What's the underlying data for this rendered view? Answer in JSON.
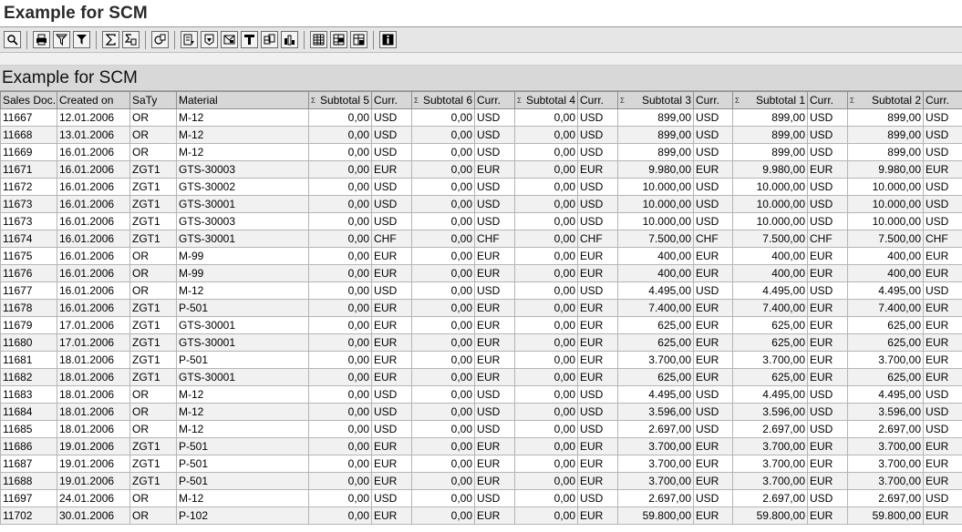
{
  "window": {
    "title": "Example for SCM"
  },
  "toolbar": {
    "buttons": [
      {
        "name": "details-icon",
        "group": 1
      },
      {
        "name": "print-icon",
        "group": 2
      },
      {
        "name": "filter-icon",
        "group": 2
      },
      {
        "name": "set-filter-icon",
        "group": 2
      },
      {
        "name": "total-icon",
        "group": 3
      },
      {
        "name": "subtotal-icon",
        "group": 3
      },
      {
        "name": "print-preview-icon",
        "group": 4
      },
      {
        "name": "export-icon",
        "group": 5
      },
      {
        "name": "local-file-icon",
        "group": 5
      },
      {
        "name": "mail-icon",
        "group": 5
      },
      {
        "name": "word-processing-icon",
        "group": 5
      },
      {
        "name": "spreadsheet-icon",
        "group": 5
      },
      {
        "name": "graphic-icon",
        "group": 5
      },
      {
        "name": "change-layout-icon",
        "group": 6
      },
      {
        "name": "select-layout-icon",
        "group": 6
      },
      {
        "name": "save-layout-icon",
        "group": 6
      },
      {
        "name": "information-icon",
        "group": 7
      }
    ]
  },
  "alv": {
    "title": "Example for SCM",
    "columns": [
      {
        "label": "Sales Doc.",
        "num": false,
        "sigma": false
      },
      {
        "label": "Created on",
        "num": false,
        "sigma": false
      },
      {
        "label": "SaTy",
        "num": false,
        "sigma": false
      },
      {
        "label": "Material",
        "num": false,
        "sigma": false
      },
      {
        "label": "Subtotal 5",
        "num": true,
        "sigma": true
      },
      {
        "label": "Curr.",
        "num": false,
        "sigma": false
      },
      {
        "label": "Subtotal 6",
        "num": true,
        "sigma": true
      },
      {
        "label": "Curr.",
        "num": false,
        "sigma": false
      },
      {
        "label": "Subtotal 4",
        "num": true,
        "sigma": true
      },
      {
        "label": "Curr.",
        "num": false,
        "sigma": false
      },
      {
        "label": "Subtotal 3",
        "num": true,
        "sigma": true
      },
      {
        "label": "Curr.",
        "num": false,
        "sigma": false
      },
      {
        "label": "Subtotal 1",
        "num": true,
        "sigma": true
      },
      {
        "label": "Curr.",
        "num": false,
        "sigma": false
      },
      {
        "label": "Subtotal 2",
        "num": true,
        "sigma": true
      },
      {
        "label": "Curr.",
        "num": false,
        "sigma": false
      }
    ],
    "sigma_symbol": "Σ",
    "rows": [
      [
        "11667",
        "12.01.2006",
        "OR",
        "M-12",
        "0,00",
        "USD",
        "0,00",
        "USD",
        "0,00",
        "USD",
        "899,00",
        "USD",
        "899,00",
        "USD",
        "899,00",
        "USD"
      ],
      [
        "11668",
        "13.01.2006",
        "OR",
        "M-12",
        "0,00",
        "USD",
        "0,00",
        "USD",
        "0,00",
        "USD",
        "899,00",
        "USD",
        "899,00",
        "USD",
        "899,00",
        "USD"
      ],
      [
        "11669",
        "16.01.2006",
        "OR",
        "M-12",
        "0,00",
        "USD",
        "0,00",
        "USD",
        "0,00",
        "USD",
        "899,00",
        "USD",
        "899,00",
        "USD",
        "899,00",
        "USD"
      ],
      [
        "11671",
        "16.01.2006",
        "ZGT1",
        "GTS-30003",
        "0,00",
        "EUR",
        "0,00",
        "EUR",
        "0,00",
        "EUR",
        "9.980,00",
        "EUR",
        "9.980,00",
        "EUR",
        "9.980,00",
        "EUR"
      ],
      [
        "11672",
        "16.01.2006",
        "ZGT1",
        "GTS-30002",
        "0,00",
        "USD",
        "0,00",
        "USD",
        "0,00",
        "USD",
        "10.000,00",
        "USD",
        "10.000,00",
        "USD",
        "10.000,00",
        "USD"
      ],
      [
        "11673",
        "16.01.2006",
        "ZGT1",
        "GTS-30001",
        "0,00",
        "USD",
        "0,00",
        "USD",
        "0,00",
        "USD",
        "10.000,00",
        "USD",
        "10.000,00",
        "USD",
        "10.000,00",
        "USD"
      ],
      [
        "11673",
        "16.01.2006",
        "ZGT1",
        "GTS-30003",
        "0,00",
        "USD",
        "0,00",
        "USD",
        "0,00",
        "USD",
        "10.000,00",
        "USD",
        "10.000,00",
        "USD",
        "10.000,00",
        "USD"
      ],
      [
        "11674",
        "16.01.2006",
        "ZGT1",
        "GTS-30001",
        "0,00",
        "CHF",
        "0,00",
        "CHF",
        "0,00",
        "CHF",
        "7.500,00",
        "CHF",
        "7.500,00",
        "CHF",
        "7.500,00",
        "CHF"
      ],
      [
        "11675",
        "16.01.2006",
        "OR",
        "M-99",
        "0,00",
        "EUR",
        "0,00",
        "EUR",
        "0,00",
        "EUR",
        "400,00",
        "EUR",
        "400,00",
        "EUR",
        "400,00",
        "EUR"
      ],
      [
        "11676",
        "16.01.2006",
        "OR",
        "M-99",
        "0,00",
        "EUR",
        "0,00",
        "EUR",
        "0,00",
        "EUR",
        "400,00",
        "EUR",
        "400,00",
        "EUR",
        "400,00",
        "EUR"
      ],
      [
        "11677",
        "16.01.2006",
        "OR",
        "M-12",
        "0,00",
        "USD",
        "0,00",
        "USD",
        "0,00",
        "USD",
        "4.495,00",
        "USD",
        "4.495,00",
        "USD",
        "4.495,00",
        "USD"
      ],
      [
        "11678",
        "16.01.2006",
        "ZGT1",
        "P-501",
        "0,00",
        "EUR",
        "0,00",
        "EUR",
        "0,00",
        "EUR",
        "7.400,00",
        "EUR",
        "7.400,00",
        "EUR",
        "7.400,00",
        "EUR"
      ],
      [
        "11679",
        "17.01.2006",
        "ZGT1",
        "GTS-30001",
        "0,00",
        "EUR",
        "0,00",
        "EUR",
        "0,00",
        "EUR",
        "625,00",
        "EUR",
        "625,00",
        "EUR",
        "625,00",
        "EUR"
      ],
      [
        "11680",
        "17.01.2006",
        "ZGT1",
        "GTS-30001",
        "0,00",
        "EUR",
        "0,00",
        "EUR",
        "0,00",
        "EUR",
        "625,00",
        "EUR",
        "625,00",
        "EUR",
        "625,00",
        "EUR"
      ],
      [
        "11681",
        "18.01.2006",
        "ZGT1",
        "P-501",
        "0,00",
        "EUR",
        "0,00",
        "EUR",
        "0,00",
        "EUR",
        "3.700,00",
        "EUR",
        "3.700,00",
        "EUR",
        "3.700,00",
        "EUR"
      ],
      [
        "11682",
        "18.01.2006",
        "ZGT1",
        "GTS-30001",
        "0,00",
        "EUR",
        "0,00",
        "EUR",
        "0,00",
        "EUR",
        "625,00",
        "EUR",
        "625,00",
        "EUR",
        "625,00",
        "EUR"
      ],
      [
        "11683",
        "18.01.2006",
        "OR",
        "M-12",
        "0,00",
        "USD",
        "0,00",
        "USD",
        "0,00",
        "USD",
        "4.495,00",
        "USD",
        "4.495,00",
        "USD",
        "4.495,00",
        "USD"
      ],
      [
        "11684",
        "18.01.2006",
        "OR",
        "M-12",
        "0,00",
        "USD",
        "0,00",
        "USD",
        "0,00",
        "USD",
        "3.596,00",
        "USD",
        "3.596,00",
        "USD",
        "3.596,00",
        "USD"
      ],
      [
        "11685",
        "18.01.2006",
        "OR",
        "M-12",
        "0,00",
        "USD",
        "0,00",
        "USD",
        "0,00",
        "USD",
        "2.697,00",
        "USD",
        "2.697,00",
        "USD",
        "2.697,00",
        "USD"
      ],
      [
        "11686",
        "19.01.2006",
        "ZGT1",
        "P-501",
        "0,00",
        "EUR",
        "0,00",
        "EUR",
        "0,00",
        "EUR",
        "3.700,00",
        "EUR",
        "3.700,00",
        "EUR",
        "3.700,00",
        "EUR"
      ],
      [
        "11687",
        "19.01.2006",
        "ZGT1",
        "P-501",
        "0,00",
        "EUR",
        "0,00",
        "EUR",
        "0,00",
        "EUR",
        "3.700,00",
        "EUR",
        "3.700,00",
        "EUR",
        "3.700,00",
        "EUR"
      ],
      [
        "11688",
        "19.01.2006",
        "ZGT1",
        "P-501",
        "0,00",
        "EUR",
        "0,00",
        "EUR",
        "0,00",
        "EUR",
        "3.700,00",
        "EUR",
        "3.700,00",
        "EUR",
        "3.700,00",
        "EUR"
      ],
      [
        "11697",
        "24.01.2006",
        "OR",
        "M-12",
        "0,00",
        "USD",
        "0,00",
        "USD",
        "0,00",
        "USD",
        "2.697,00",
        "USD",
        "2.697,00",
        "USD",
        "2.697,00",
        "USD"
      ],
      [
        "11702",
        "30.01.2006",
        "OR",
        "P-102",
        "0,00",
        "EUR",
        "0,00",
        "EUR",
        "0,00",
        "EUR",
        "59.800,00",
        "EUR",
        "59.800,00",
        "EUR",
        "59.800,00",
        "EUR"
      ]
    ]
  }
}
